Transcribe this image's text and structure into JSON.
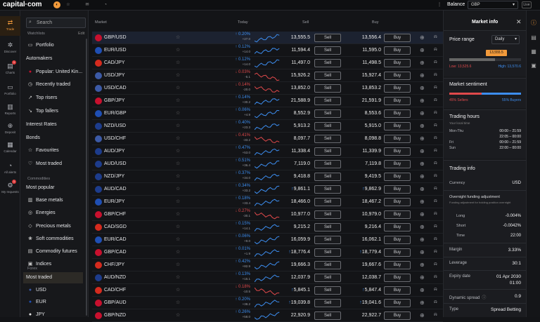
{
  "app": {
    "logo": "capital·com",
    "balance_label": "Balance",
    "balance_currency": "GBP",
    "mode": "Live"
  },
  "rail": [
    {
      "label": "Trade",
      "icon": "trade-icon",
      "active": true,
      "badge": ""
    },
    {
      "label": "Discover",
      "icon": "discover-icon",
      "badge": ""
    },
    {
      "label": "Charts",
      "icon": "charts-icon",
      "badge": "1"
    },
    {
      "label": "Portfolio",
      "icon": "portfolio-icon",
      "badge": ""
    },
    {
      "label": "Reports",
      "icon": "reports-icon",
      "badge": ""
    },
    {
      "label": "Deposit",
      "icon": "deposit-icon",
      "badge": ""
    },
    {
      "label": "Calendar",
      "icon": "calendar-icon",
      "badge": ""
    },
    {
      "label": "All alerts",
      "icon": "bell-icon",
      "badge": ""
    },
    {
      "label": "My requests",
      "icon": "requests-icon",
      "badge": "1"
    }
  ],
  "sidebar": {
    "search_placeholder": "Search",
    "watchlists_label": "Watchlists",
    "edit_label": "Edit",
    "watchlists": [
      {
        "label": "Portfolio",
        "icon": "portfolio-icon"
      },
      {
        "label": "Automakers",
        "icon": ""
      },
      {
        "label": "Popular: United Kin...",
        "icon": "uk-flag-icon"
      },
      {
        "label": "Recently traded",
        "icon": "clock-icon"
      },
      {
        "label": "Top risers",
        "icon": "trend-up-icon"
      },
      {
        "label": "Top fallers",
        "icon": "trend-down-icon"
      },
      {
        "label": "Interest Rates",
        "icon": ""
      },
      {
        "label": "Bonds",
        "icon": ""
      },
      {
        "label": "Favourites",
        "icon": "star-icon"
      },
      {
        "label": "Most traded",
        "icon": "heart-icon"
      }
    ],
    "commodities_label": "Commodities",
    "commodities": [
      {
        "label": "Most popular",
        "icon": ""
      },
      {
        "label": "Base metals",
        "icon": "metal-icon"
      },
      {
        "label": "Energies",
        "icon": "energy-icon"
      },
      {
        "label": "Precious metals",
        "icon": "gem-icon"
      },
      {
        "label": "Soft commodities",
        "icon": "soft-icon"
      },
      {
        "label": "Commodity futures",
        "icon": "futures-icon"
      },
      {
        "label": "Indices",
        "icon": "indices-icon"
      }
    ],
    "forex_label": "Forex",
    "forex": [
      {
        "label": "Most traded",
        "icon": "",
        "selected": true
      },
      {
        "label": "USD",
        "icon": "us-flag-icon"
      },
      {
        "label": "EUR",
        "icon": "eu-flag-icon"
      },
      {
        "label": "JPY",
        "icon": "jp-flag-icon"
      }
    ]
  },
  "table": {
    "headers": {
      "market": "Market",
      "today": "Today",
      "sell": "Sell",
      "buy": "Buy"
    },
    "sell_label": "Sell",
    "buy_label": "Buy",
    "rows": [
      {
        "name": "GBP/USD",
        "flag": "#c8102e",
        "chg": "0.20%",
        "sub": "+27.0",
        "dir": "up",
        "sell": "13,555.5",
        "buy": "13,556.4",
        "mark": false
      },
      {
        "name": "EUR/USD",
        "flag": "#1f4fb4",
        "chg": "0.12%",
        "sub": "+14.0",
        "dir": "up",
        "sell": "11,594.4",
        "buy": "11,595.0",
        "mark": false
      },
      {
        "name": "CAD/JPY",
        "flag": "#d52b1e",
        "chg": "0.12%",
        "sub": "+14.0",
        "dir": "up",
        "sell": "11,497.0",
        "buy": "11,498.5",
        "mark": false
      },
      {
        "name": "USD/JPY",
        "flag": "#3c5aa6",
        "chg": "0.03%",
        "sub": "-5.1",
        "dir": "dn",
        "sell": "15,926.2",
        "buy": "15,927.4",
        "mark": false
      },
      {
        "name": "USD/CAD",
        "flag": "#3c5aa6",
        "chg": "0.14%",
        "sub": "-20.0",
        "dir": "dn",
        "sell": "13,852.0",
        "buy": "13,853.2",
        "mark": false
      },
      {
        "name": "GBP/JPY",
        "flag": "#c8102e",
        "chg": "0.14%",
        "sub": "+30.2",
        "dir": "up",
        "sell": "21,588.9",
        "buy": "21,591.9",
        "mark": false
      },
      {
        "name": "EUR/GBP",
        "flag": "#1f4fb4",
        "chg": "0.06%",
        "sub": "+4.9",
        "dir": "up",
        "sell": "8,552.9",
        "buy": "8,553.6",
        "mark": false
      },
      {
        "name": "NZD/USD",
        "flag": "#1d3c8c",
        "chg": "0.40%",
        "sub": "+23.3",
        "dir": "up",
        "sell": "5,913.2",
        "buy": "5,915.0",
        "mark": false
      },
      {
        "name": "USD/CHF",
        "flag": "#3c5aa6",
        "chg": "0.41%",
        "sub": "-33.2",
        "dir": "dn",
        "sell": "8,097.7",
        "buy": "8,098.8",
        "mark": false
      },
      {
        "name": "AUD/JPY",
        "flag": "#1d3c8c",
        "chg": "0.47%",
        "sub": "+53.0",
        "dir": "up",
        "sell": "11,338.4",
        "buy": "11,339.9",
        "mark": false
      },
      {
        "name": "AUD/USD",
        "flag": "#1d3c8c",
        "chg": "0.51%",
        "sub": "+36.4",
        "dir": "up",
        "sell": "7,119.0",
        "buy": "7,119.8",
        "mark": false
      },
      {
        "name": "NZD/JPY",
        "flag": "#1d3c8c",
        "chg": "0.37%",
        "sub": "+34.0",
        "dir": "up",
        "sell": "9,418.8",
        "buy": "9,419.5",
        "mark": false
      },
      {
        "name": "AUD/CAD",
        "flag": "#1d3c8c",
        "chg": "0.34%",
        "sub": "+33.2",
        "dir": "up",
        "sell": "9,861.1",
        "buy": "9,862.9",
        "mark": true
      },
      {
        "name": "EUR/JPY",
        "flag": "#1f4fb4",
        "chg": "0.18%",
        "sub": "+33.4",
        "dir": "up",
        "sell": "18,466.0",
        "buy": "18,467.2",
        "mark": false
      },
      {
        "name": "GBP/CHF",
        "flag": "#c8102e",
        "chg": "0.27%",
        "sub": "-30.1",
        "dir": "dn",
        "sell": "10,977.0",
        "buy": "10,979.0",
        "mark": false
      },
      {
        "name": "CAD/SGD",
        "flag": "#d52b1e",
        "chg": "0.15%",
        "sub": "+14.1",
        "dir": "up",
        "sell": "9,215.2",
        "buy": "9,216.4",
        "mark": false
      },
      {
        "name": "EUR/CAD",
        "flag": "#1f4fb4",
        "chg": "0.06%",
        "sub": "+9.0",
        "dir": "up",
        "sell": "16,059.9",
        "buy": "16,062.1",
        "mark": false
      },
      {
        "name": "GBP/CAD",
        "flag": "#c8102e",
        "chg": "0.01%",
        "sub": "+1.9",
        "dir": "up",
        "sell": "18,776.4",
        "buy": "18,779.4",
        "mark": true
      },
      {
        "name": "CHF/JPY",
        "flag": "#d52b1e",
        "chg": "0.42%",
        "sub": "+82.9",
        "dir": "up",
        "sell": "19,666.3",
        "buy": "19,667.6",
        "mark": false
      },
      {
        "name": "AUD/NZD",
        "flag": "#1d3c8c",
        "chg": "0.13%",
        "sub": "+15.1",
        "dir": "up",
        "sell": "12,037.9",
        "buy": "12,038.7",
        "mark": false
      },
      {
        "name": "CAD/CHF",
        "flag": "#d52b1e",
        "chg": "0.18%",
        "sub": "-10.5",
        "dir": "dn",
        "sell": "5,845.1",
        "buy": "5,847.4",
        "mark": true
      },
      {
        "name": "GBP/AUD",
        "flag": "#c8102e",
        "chg": "0.20%",
        "sub": "+38.2",
        "dir": "up",
        "sell": "19,039.8",
        "buy": "19,041.6",
        "mark": true
      },
      {
        "name": "GBP/NZD",
        "flag": "#c8102e",
        "chg": "0.26%",
        "sub": "+58.0",
        "dir": "up",
        "sell": "22,920.9",
        "buy": "22,922.7",
        "mark": false
      }
    ]
  },
  "panel": {
    "title": "Market info",
    "price_range_label": "Price range",
    "range_period": "Daily",
    "current_price": "13,555.5",
    "low_label": "Low: 13,525.6",
    "high_label": "High: 13,570.6",
    "sentiment_title": "Market sentiment",
    "sellers_label": "45% Sellers",
    "buyers_label": "55% Buyers",
    "sellers_pct": 45,
    "hours_title": "Trading hours",
    "hours_subtitle": "Your local time",
    "hours": [
      {
        "day": "Mon-Thu",
        "time": "00:00 – 21:59"
      },
      {
        "day": "",
        "time": "22:05 – 00:00"
      },
      {
        "day": "Fri",
        "time": "00:00 – 21:59"
      },
      {
        "day": "Sun",
        "time": "22:00 – 00:00"
      }
    ],
    "info_title": "Trading info",
    "currency_label": "Currency",
    "currency_value": "USD",
    "overnight_title": "Overnight funding adjustment",
    "overnight_desc": "Funding adjustment for holding position overnight",
    "long_label": "Long",
    "long_value": "-0.004%",
    "short_label": "Short",
    "short_value": "-0.0042%",
    "time_label": "Time",
    "time_value": "22:00",
    "margin_label": "Margin",
    "margin_value": "3.33%",
    "leverage_label": "Leverage",
    "leverage_value": "30:1",
    "expiry_label": "Expiry date",
    "expiry_value": "01 Apr 2030",
    "expiry_time": "01:00",
    "spread_label": "Dynamic spread",
    "spread_value": "0.9",
    "type_label": "Type",
    "type_value": "Spread Betting"
  },
  "colors": {
    "accent": "#f29a3b",
    "up": "#3d8ef0",
    "down": "#e0494b"
  }
}
